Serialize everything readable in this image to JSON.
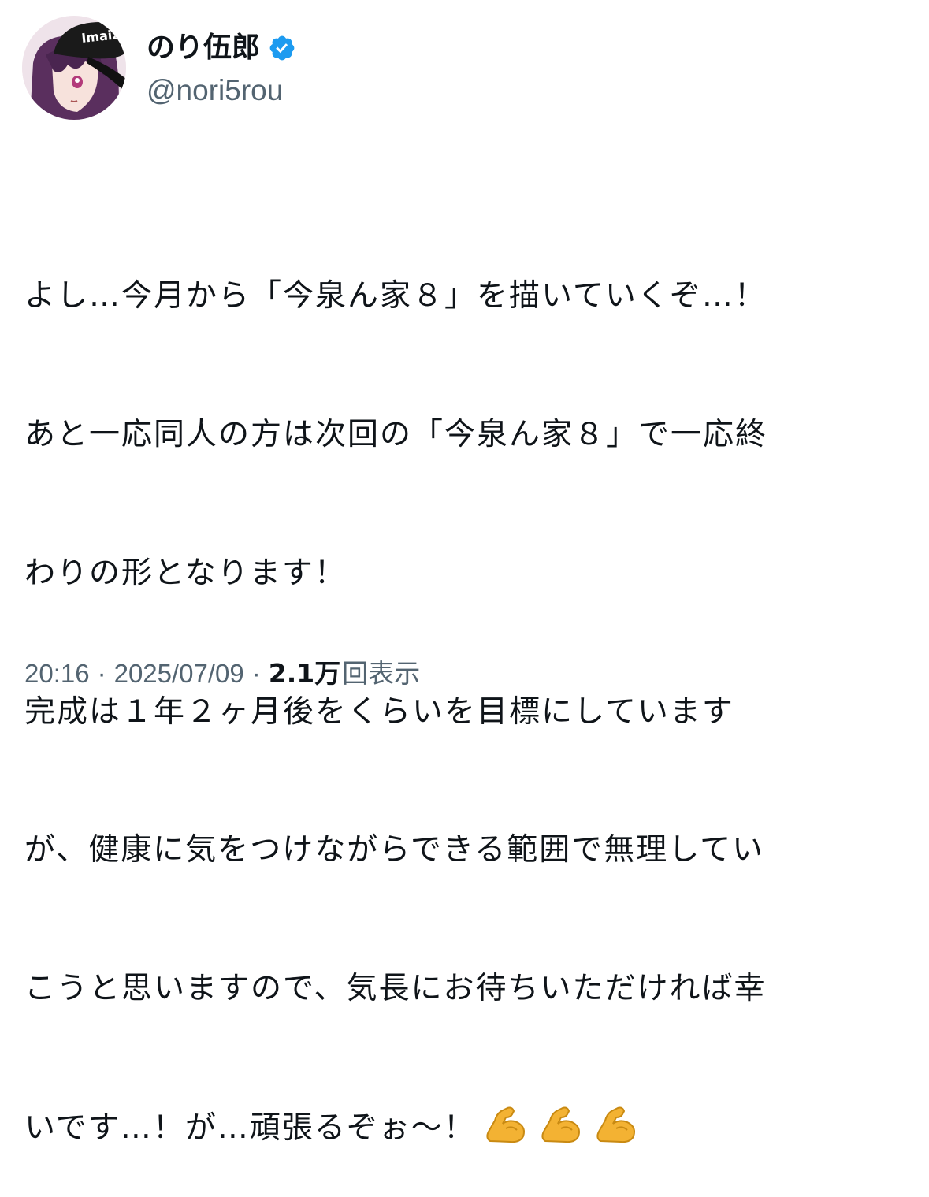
{
  "author": {
    "display_name": "のり伍郎",
    "handle": "@nori5rou",
    "avatar_cap_text": "Imaiz"
  },
  "tweet": {
    "lines": [
      "よし…今月から「今泉ん家８」を描いていくぞ…！",
      "あと一応同人の方は次回の「今泉ん家８」で一応終",
      "わりの形となります！",
      "完成は１年２ヶ月後をくらいを目標にしています",
      "が、健康に気をつけながらできる範囲で無理してい",
      "こうと思いますので、気長にお待ちいただければ幸",
      "いです…！が…頑張るぞぉ～！"
    ],
    "emoji_icons": [
      "flexed-biceps",
      "flexed-biceps",
      "flexed-biceps"
    ]
  },
  "meta": {
    "time": "20:16",
    "separator": "·",
    "date": "2025/07/09",
    "views_count": "2.1万",
    "views_label": "回表示"
  },
  "colors": {
    "text": "#0f1419",
    "secondary": "#536471",
    "verified": "#1d9bf0"
  }
}
